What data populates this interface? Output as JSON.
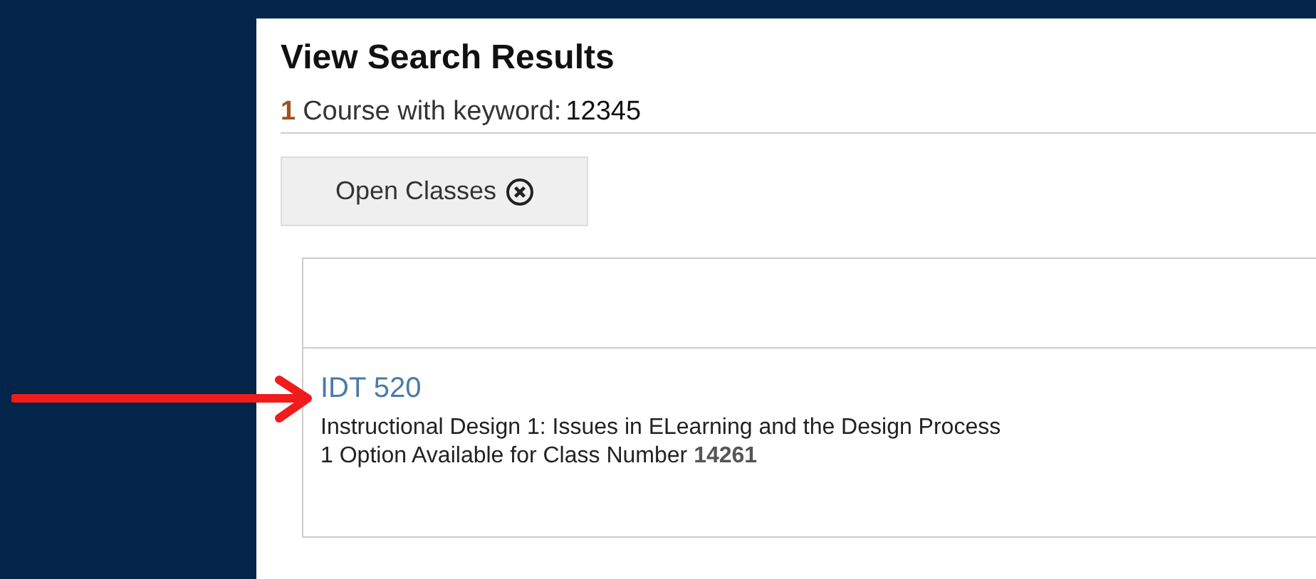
{
  "title": "View Search Results",
  "summary": {
    "count": "1",
    "text": "Course with keyword:",
    "keyword": "12345"
  },
  "filter_chip": {
    "label": "Open Classes"
  },
  "results": [
    {
      "course": "IDT 520",
      "description": "Instructional Design 1: Issues in ELearning and the Design Process",
      "options": "1 Option Available for Class Number **14261**"
    }
  ]
}
